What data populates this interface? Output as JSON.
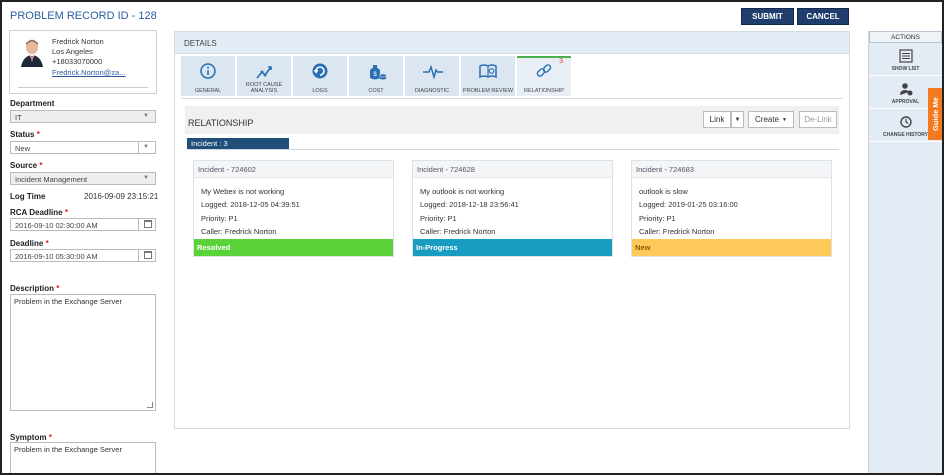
{
  "header": {
    "title": "PROBLEM RECORD ID - 128",
    "submit_label": "SUBMIT",
    "cancel_label": "CANCEL"
  },
  "user": {
    "name": "Fredrick Norton",
    "location": "Los Angeles",
    "phone": "+18033070000",
    "email": "Fredrick.Norton@za..."
  },
  "form": {
    "department_label": "Department",
    "department_value": "IT",
    "status_label": "Status",
    "status_value": "New",
    "source_label": "Source",
    "source_value": "Incident Management",
    "logtime_label": "Log Time",
    "logtime_value": "2016-09-09 23:15:21",
    "rca_label": "RCA Deadline",
    "rca_value": "2016-09-10 02:30:00 AM",
    "deadline_label": "Deadline",
    "deadline_value": "2016-09-10 05:30:00 AM",
    "description_label": "Description",
    "description_value": "Problem in the Exchange Server",
    "symptom_label": "Symptom",
    "symptom_value": "Problem in the Exchange Server",
    "required_marker": "*"
  },
  "details": {
    "title": "DETAILS",
    "tabs": [
      {
        "label": "GENERAL",
        "icon": "info-icon"
      },
      {
        "label": "ROOT CAUSE ANALYSIS",
        "icon": "root-cause-icon"
      },
      {
        "label": "LOGS",
        "icon": "logs-icon"
      },
      {
        "label": "COST",
        "icon": "cost-icon"
      },
      {
        "label": "DIAGNOSTIC",
        "icon": "diagnostic-icon"
      },
      {
        "label": "PROBLEM REVIEW",
        "icon": "review-icon"
      },
      {
        "label": "RELATIONSHIP",
        "icon": "link-icon",
        "count": "3"
      }
    ]
  },
  "relationship": {
    "title": "RELATIONSHIP",
    "link_label": "Link",
    "create_label": "Create",
    "delink_label": "De-Link",
    "incident_tab_label": "Incident : 3",
    "cards": [
      {
        "id": "Incident - 724602",
        "summary": "My Webex is not working",
        "logged": "Logged: 2018-12-05 04:39:51",
        "priority": "Priority: P1",
        "caller": "Caller: Fredrick Norton",
        "status": "Resolved",
        "color": "#5ad33a",
        "text_color": "#ffffff"
      },
      {
        "id": "Incident - 724628",
        "summary": "My outlook is not working",
        "logged": "Logged: 2018-12-18 23:56:41",
        "priority": "Priority: P1",
        "caller": "Caller: Fredrick Norton",
        "status": "In-Progress",
        "color": "#1a9bc0",
        "text_color": "#ffffff"
      },
      {
        "id": "Incident - 724683",
        "summary": "outlook is slow",
        "logged": "Logged: 2019-01-25 03:16:00",
        "priority": "Priority: P1",
        "caller": "Caller: Fredrick Norton",
        "status": "New",
        "color": "#ffc95a",
        "text_color": "#8a5a00"
      }
    ]
  },
  "actions": {
    "title": "ACTIONS",
    "items": [
      {
        "label": "SHOW LIST",
        "icon": "list-icon"
      },
      {
        "label": "APPROVAL",
        "icon": "approval-icon"
      },
      {
        "label": "CHANGE HISTORY",
        "icon": "history-icon"
      }
    ],
    "guide_label": "Guide Me"
  }
}
